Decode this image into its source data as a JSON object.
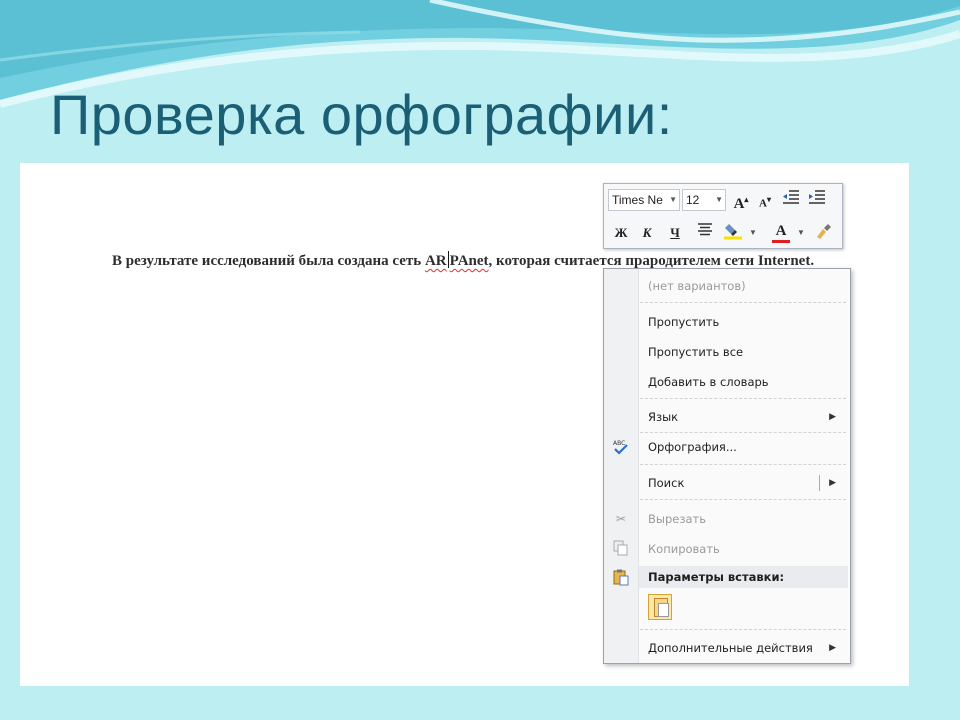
{
  "slide": {
    "title": "Проверка орфографии:"
  },
  "document": {
    "text_before": "В результате исследований была создана сеть ",
    "misspelled_a": "AR",
    "misspelled_b": "PAnet",
    "text_after": ", которая считается прародителем сети Internet."
  },
  "mini_toolbar": {
    "font_name": "Times Ne",
    "font_size": "12",
    "grow_font": "A",
    "shrink_font": "A",
    "bold": "Ж",
    "italic": "К",
    "underline": "Ч",
    "font_color": "A",
    "icons": {
      "grow": "grow-font-icon",
      "shrink": "shrink-font-icon",
      "decrease_indent": "decrease-indent-icon",
      "increase_indent": "increase-indent-icon",
      "center": "align-center-icon",
      "highlight": "highlighter-icon",
      "font_color": "font-color-icon",
      "format_painter": "format-painter-icon"
    }
  },
  "context_menu": {
    "no_suggestions": "(нет вариантов)",
    "ignore": "Пропустить",
    "ignore_all": "Пропустить все",
    "add_to_dictionary": "Добавить в словарь",
    "language": "Язык",
    "spelling": "Орфография...",
    "search": "Поиск",
    "cut": "Вырезать",
    "copy": "Копировать",
    "paste_options": "Параметры вставки:",
    "more_actions": "Дополнительные действия",
    "colors": {
      "highlight_bar": "#e9ebee",
      "disabled_text": "#9a9a9a"
    }
  },
  "colors": {
    "title": "#1a5f75",
    "background": "#bdeef2",
    "wave_light": "#e6fafc",
    "wave_dark": "#67c8d8",
    "spell_underline": "#e02020"
  }
}
